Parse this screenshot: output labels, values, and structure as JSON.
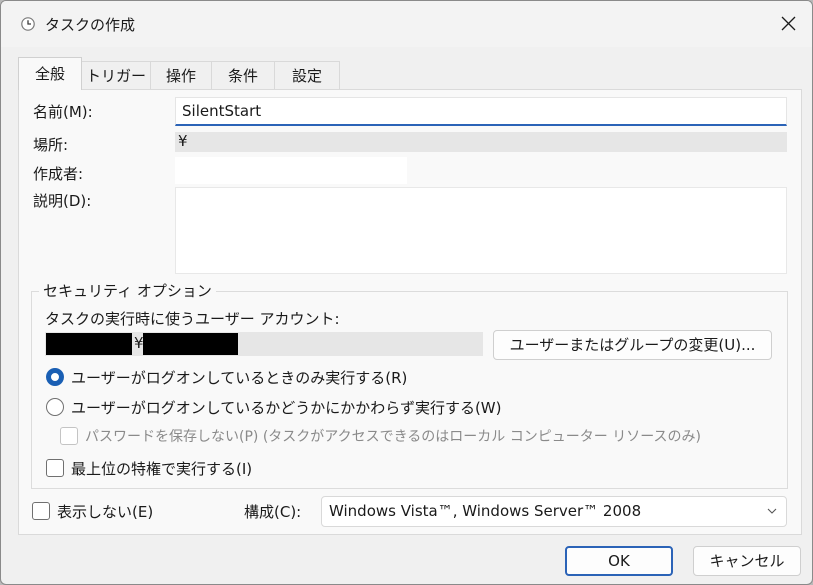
{
  "window": {
    "title": "タスクの作成"
  },
  "tabs": [
    "全般",
    "トリガー",
    "操作",
    "条件",
    "設定"
  ],
  "general": {
    "name_label": "名前(M):",
    "name_value": "SilentStart",
    "location_label": "場所:",
    "location_value": "¥",
    "author_label": "作成者:",
    "author_value": "",
    "description_label": "説明(D):",
    "description_value": ""
  },
  "security": {
    "group_title": "セキュリティ オプション",
    "account_label": "タスクの実行時に使うユーザー アカウント:",
    "account_separator": "¥",
    "change_button": "ユーザーまたはグループの変更(U)...",
    "radio_logged_on": "ユーザーがログオンしているときのみ実行する(R)",
    "radio_whether": "ユーザーがログオンしているかどうかにかかわらず実行する(W)",
    "no_store_password": "パスワードを保存しない(P) (タスクがアクセスできるのはローカル コンピューター リソースのみ)",
    "highest_privileges": "最上位の特権で実行する(I)"
  },
  "bottom": {
    "hidden_label": "表示しない(E)",
    "configure_label": "構成(C):",
    "configure_value": "Windows Vista™, Windows Server™ 2008"
  },
  "buttons": {
    "ok": "OK",
    "cancel": "キャンセル"
  },
  "icons": {
    "app": "task-scheduler-clock-icon",
    "close": "close-icon",
    "dropdown": "chevron-down-icon"
  },
  "colors": {
    "accent": "#2b63b7",
    "dialog_bg": "#f0f0f0",
    "panel_bg": "#f9f9f9"
  }
}
